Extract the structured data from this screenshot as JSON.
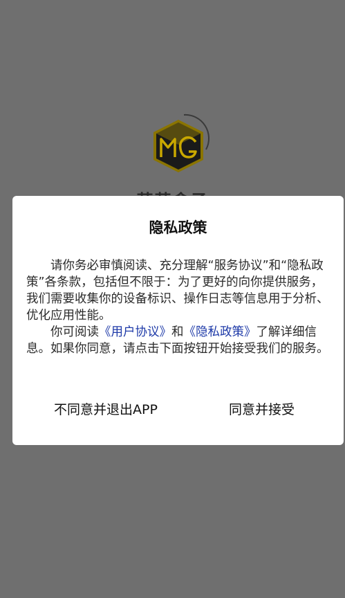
{
  "splash": {
    "app_name": "萌萌盒子",
    "logo_icon": "mg-cube-logo",
    "colors": {
      "background": "#6f6f6f",
      "logo_fill": "#1a1a1a",
      "logo_border": "#8a7400",
      "logo_accent": "#c9a800"
    }
  },
  "dialog": {
    "title": "隐私政策",
    "paragraph1": "请你务必审慎阅读、充分理解“服务协议”和“隐私政策”各条款，包括但不限于：为了更好的向你提供服务，我们需要收集你的设备标识、操作日志等信息用于分析、优化应用性能。",
    "paragraph2": {
      "prefix": "你可阅读",
      "link1": "《用户协议》",
      "middle": "和",
      "link2": "《隐私政策》",
      "suffix": "了解详细信息。如果你同意，请点击下面按钮开始接受我们的服务。"
    },
    "reject_label": "不同意并退出APP",
    "accept_label": "同意并接受",
    "colors": {
      "link": "#1e3aa8",
      "background": "#ffffff"
    }
  }
}
